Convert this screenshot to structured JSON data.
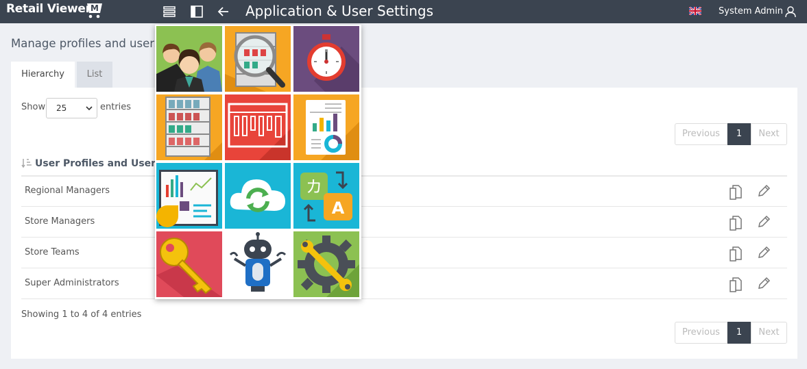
{
  "app": {
    "logo_text": "Retail Viewer",
    "logo_badge": "M"
  },
  "topbar": {
    "title": "Application & User Settings",
    "user_name": "System Admin"
  },
  "page": {
    "heading": "Manage profiles and users"
  },
  "tabs": [
    {
      "label": "Hierarchy",
      "active": true
    },
    {
      "label": "List",
      "active": false
    }
  ],
  "length_control": {
    "show_label": "Show",
    "selected": "25",
    "entries_label": "entries"
  },
  "pagination": {
    "previous": "Previous",
    "current": "1",
    "next": "Next"
  },
  "table": {
    "header": "User Profiles and Users",
    "rows": [
      {
        "name": "Regional Managers"
      },
      {
        "name": "Store Managers"
      },
      {
        "name": "Store Teams"
      },
      {
        "name": "Super Administrators"
      }
    ],
    "info": "Showing 1 to 4 of 4 entries"
  },
  "launcher": {
    "tiles": [
      {
        "icon": "users-icon",
        "bg": "#8cc152"
      },
      {
        "icon": "shelf-inspect-icon",
        "bg": "#f6a623"
      },
      {
        "icon": "stopwatch-icon",
        "bg": "#6b4c7e"
      },
      {
        "icon": "shelves-icon",
        "bg": "#f6a623"
      },
      {
        "icon": "floorplan-icon",
        "bg": "#e8443a"
      },
      {
        "icon": "report-icon",
        "bg": "#f6a623"
      },
      {
        "icon": "dashboard-icon",
        "bg": "#1ab6d6"
      },
      {
        "icon": "cloud-sync-icon",
        "bg": "#1ab6d6"
      },
      {
        "icon": "translate-icon",
        "bg": "#1ab6d6"
      },
      {
        "icon": "key-icon",
        "bg": "#e04a5a"
      },
      {
        "icon": "robot-icon",
        "bg": "#ffffff"
      },
      {
        "icon": "settings-tools-icon",
        "bg": "#8cc152"
      }
    ]
  },
  "colors": {
    "topbar": "#3b4450",
    "accent": "#3b4450",
    "page_bg": "#eef0f4"
  }
}
